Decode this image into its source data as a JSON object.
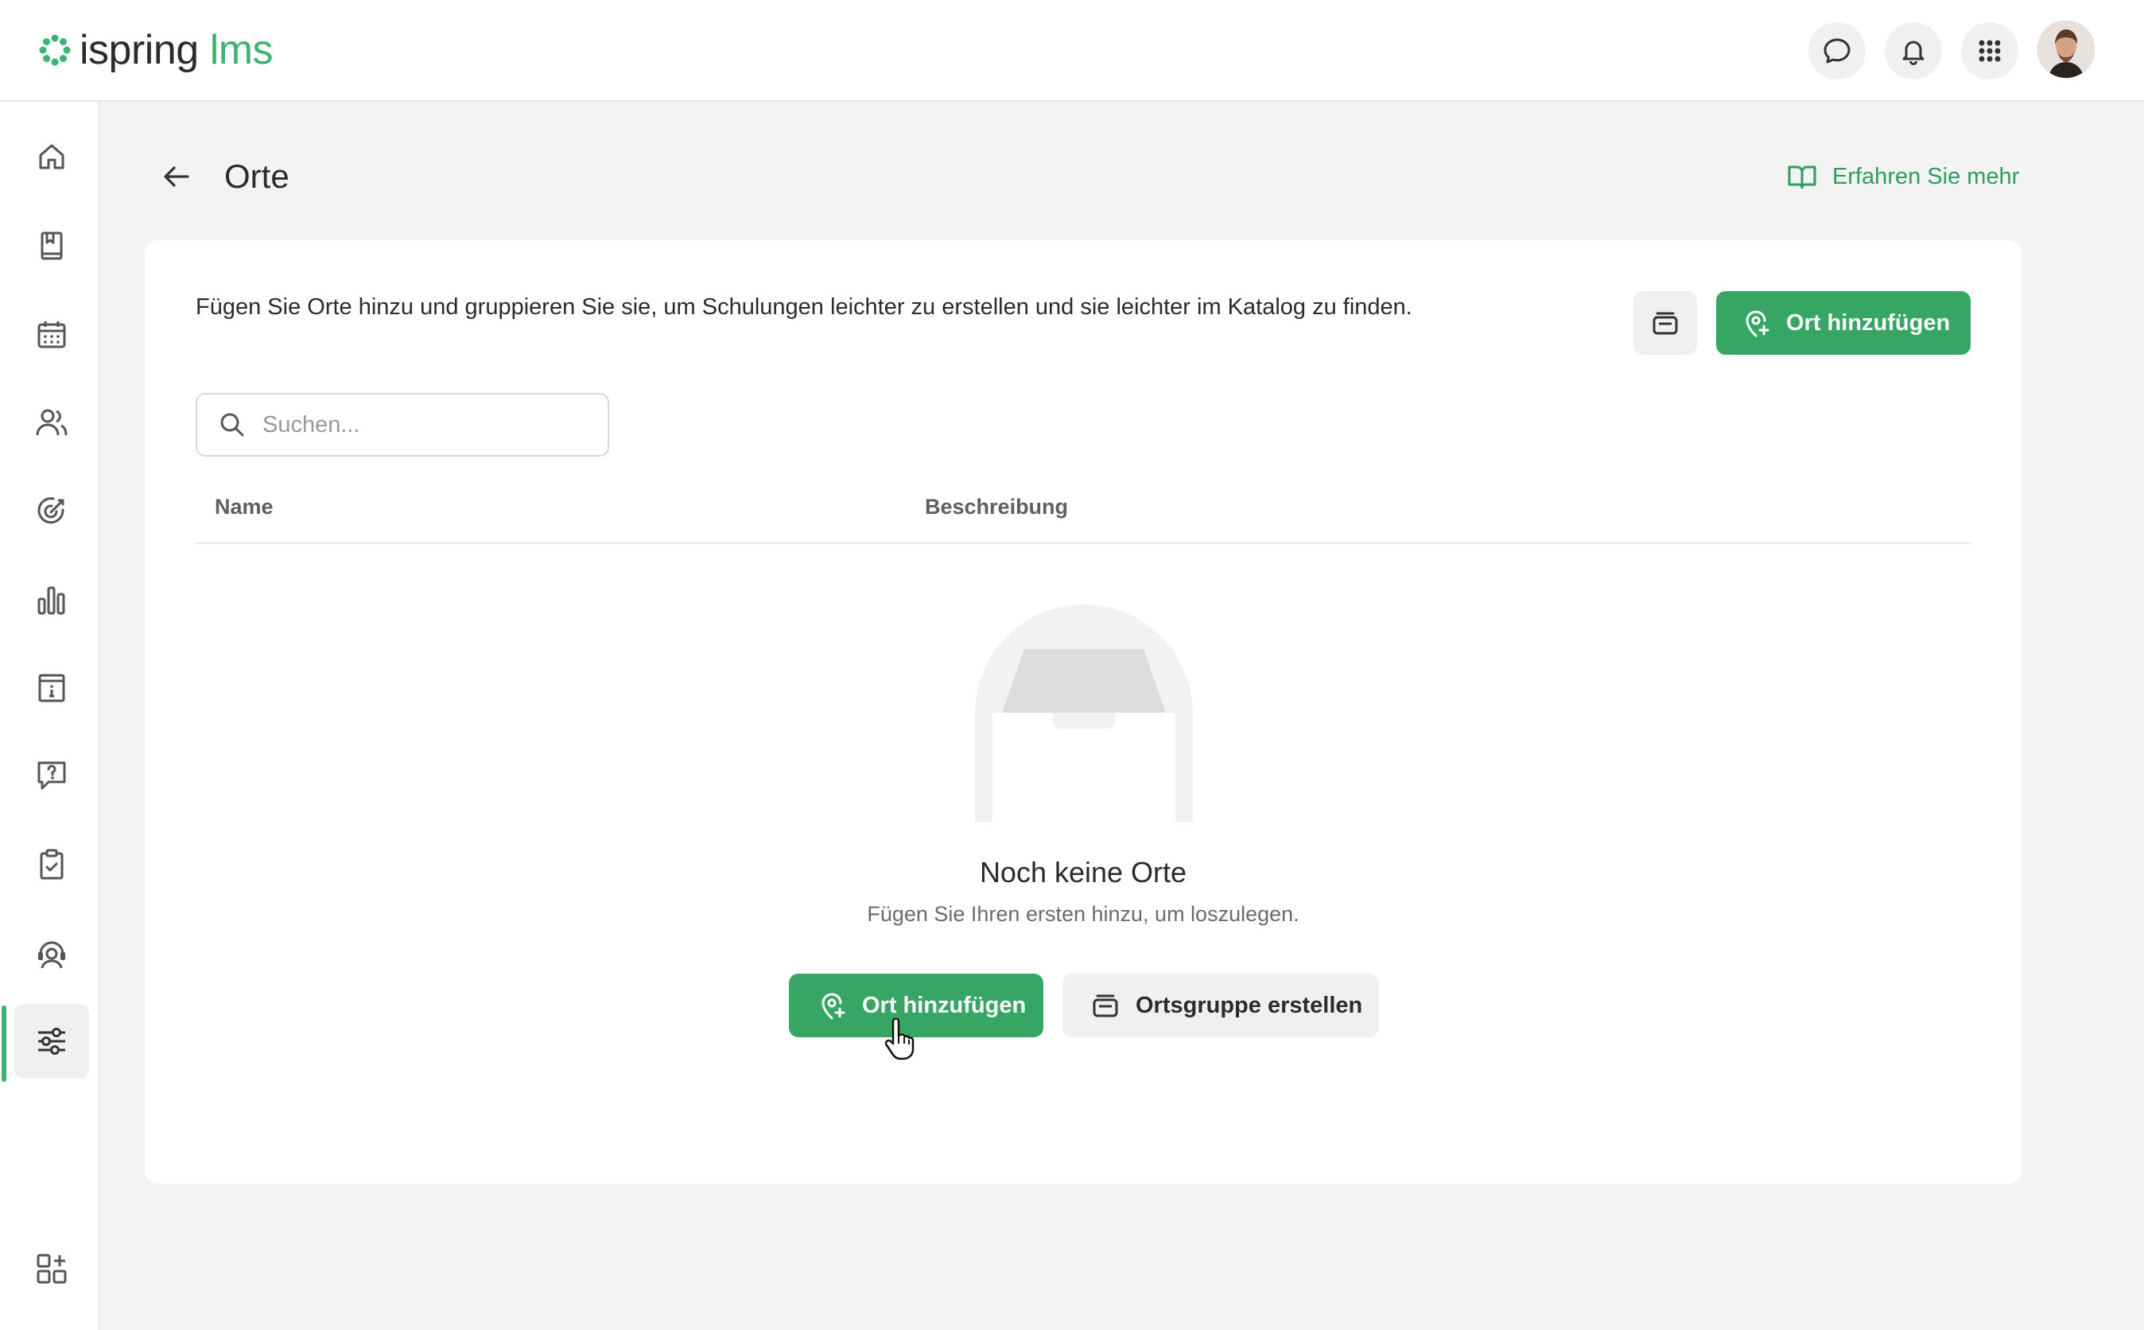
{
  "app": {
    "logo_text_primary": "ispring",
    "logo_text_secondary": "lms",
    "accent_color": "#37a564"
  },
  "topbar": {
    "icons": [
      "chat-icon",
      "bell-icon",
      "apps-grid-icon"
    ],
    "avatar": "user-avatar"
  },
  "sidebar": {
    "items": [
      {
        "icon": "home-icon"
      },
      {
        "icon": "book-icon"
      },
      {
        "icon": "calendar-icon"
      },
      {
        "icon": "users-icon"
      },
      {
        "icon": "target-icon"
      },
      {
        "icon": "bar-chart-icon"
      },
      {
        "icon": "info-board-icon"
      },
      {
        "icon": "question-chat-icon"
      },
      {
        "icon": "clipboard-check-icon"
      },
      {
        "icon": "support-agent-icon"
      },
      {
        "icon": "settings-sliders-icon",
        "active": true
      },
      {
        "icon": "add-widget-icon"
      }
    ]
  },
  "header": {
    "title": "Orte",
    "learn_more": "Erfahren Sie mehr"
  },
  "card": {
    "intro": "Fügen Sie Orte hinzu und gruppieren Sie sie, um Schulungen leichter zu erstellen und sie leichter im Katalog zu finden.",
    "add_button": "Ort hinzufügen",
    "search_placeholder": "Suchen...",
    "columns": [
      "Name",
      "Beschreibung"
    ],
    "empty": {
      "title": "Noch keine Orte",
      "subtitle": "Fügen Sie Ihren ersten hinzu, um loszulegen.",
      "add_button": "Ort hinzufügen",
      "group_button": "Ortsgruppe erstellen"
    }
  }
}
